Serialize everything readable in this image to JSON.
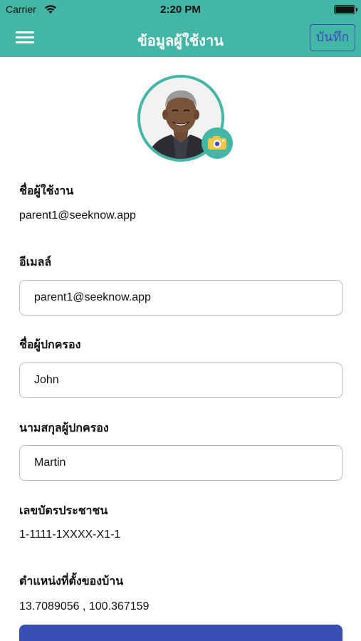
{
  "status_bar": {
    "carrier": "Carrier",
    "time": "2:20 PM"
  },
  "nav": {
    "title": "ข้อมูลผู้ใช้งาน",
    "save_label": "บันทึก",
    "menu_icon": "hamburger-menu-icon"
  },
  "profile": {
    "camera_icon": "camera-icon"
  },
  "fields": {
    "username_label": "ชื่อผู้ใช้งาน",
    "username_value": "parent1@seeknow.app",
    "email_label": "อีเมลล์",
    "email_value": "parent1@seeknow.app",
    "first_name_label": "ชื่อผู้ปกครอง",
    "first_name_value": "John",
    "last_name_label": "นามสกุลผู้ปกครอง",
    "last_name_value": "Martin",
    "id_card_label": "เลขบัตรประชาชน",
    "id_card_value": "1-1111-1XXXX-X1-1",
    "location_label": "ตำแหน่งที่ตั้งของบ้าน",
    "location_value": "13.7089056 , 100.367159"
  },
  "colors": {
    "primary": "#43b6a6",
    "accent": "#3a4db5"
  }
}
